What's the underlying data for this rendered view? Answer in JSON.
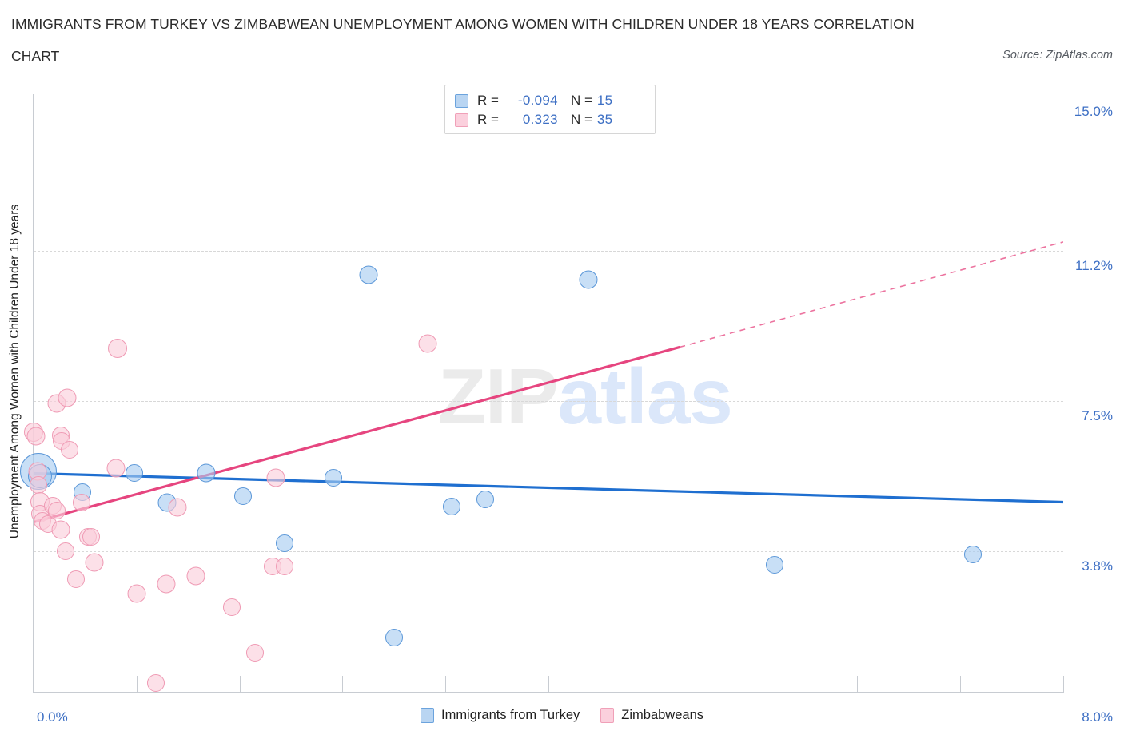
{
  "header": {
    "title_line1": "IMMIGRANTS FROM TURKEY VS ZIMBABWEAN UNEMPLOYMENT AMONG WOMEN WITH CHILDREN UNDER 18 YEARS CORRELATION",
    "title_line2": "CHART",
    "source": "Source: ZipAtlas.com"
  },
  "watermark": {
    "part1": "ZIP",
    "part2": "atlas"
  },
  "correlation_box": {
    "rows": [
      {
        "series": "Immigrants from Turkey",
        "r_label": "R =",
        "r_value": "-0.094",
        "n_label": "N =",
        "n_value": "15",
        "color": "#b9d5f2"
      },
      {
        "series": "Zimbabweans",
        "r_label": "R =",
        "r_value": "0.323",
        "n_label": "N =",
        "n_value": "35",
        "color": "#fbd0dd"
      }
    ]
  },
  "legend": {
    "items": [
      {
        "label": "Immigrants from Turkey",
        "color": "#b9d5f2"
      },
      {
        "label": "Zimbabweans",
        "color": "#fbd0dd"
      }
    ]
  },
  "chart_data": {
    "type": "scatter",
    "title": "IMMIGRANTS FROM TURKEY VS ZIMBABWEAN UNEMPLOYMENT AMONG WOMEN WITH CHILDREN UNDER 18 YEARS CORRELATION CHART",
    "xlabel": "Immigrants from Turkey",
    "ylabel": "Unemployment Among Women with Children Under 18 years",
    "xlim": [
      0.0,
      8.0
    ],
    "ylim": [
      0.45,
      15.0
    ],
    "xticks": [
      "0.0%",
      "8.0%"
    ],
    "yticks": [
      "15.0%",
      "11.2%",
      "7.5%",
      "3.8%"
    ],
    "ytick_values": [
      15.0,
      11.2,
      7.5,
      3.8
    ],
    "grid": true,
    "legend_position": "bottom-center",
    "series": [
      {
        "name": "Immigrants from Turkey",
        "color": "#b9d5f2",
        "edge_color": "#5b97d8",
        "r": -0.094,
        "n": 15,
        "trendline": {
          "x0": 0.0,
          "y0": 5.72,
          "x1": 8.0,
          "y1": 5.01,
          "color": "#1f6fd0",
          "style": "solid"
        },
        "points": [
          {
            "x": 0.04,
            "y": 5.76,
            "size": 46
          },
          {
            "x": 0.05,
            "y": 5.66,
            "size": 30
          },
          {
            "x": 0.38,
            "y": 5.25,
            "size": 22
          },
          {
            "x": 0.78,
            "y": 5.73,
            "size": 22
          },
          {
            "x": 1.04,
            "y": 5.0,
            "size": 23
          },
          {
            "x": 1.34,
            "y": 5.73,
            "size": 23
          },
          {
            "x": 1.63,
            "y": 5.15,
            "size": 22
          },
          {
            "x": 1.95,
            "y": 3.99,
            "size": 22
          },
          {
            "x": 2.6,
            "y": 10.62,
            "size": 23
          },
          {
            "x": 2.33,
            "y": 5.61,
            "size": 22
          },
          {
            "x": 2.8,
            "y": 1.68,
            "size": 22
          },
          {
            "x": 3.25,
            "y": 4.9,
            "size": 22
          },
          {
            "x": 3.51,
            "y": 5.07,
            "size": 22
          },
          {
            "x": 4.31,
            "y": 10.5,
            "size": 23
          },
          {
            "x": 5.76,
            "y": 3.47,
            "size": 22
          },
          {
            "x": 7.3,
            "y": 3.73,
            "size": 22
          }
        ]
      },
      {
        "name": "Zimbabweans",
        "color": "#fbd0dd",
        "edge_color": "#ef9ab4",
        "r": 0.323,
        "n": 35,
        "trendline": {
          "x0": 0.0,
          "y0": 4.52,
          "x1": 5.02,
          "y1": 8.83,
          "x_dash_end": 8.0,
          "y_dash_end": 11.42,
          "color": "#e6457f",
          "style": "solid-then-dashed"
        },
        "points": [
          {
            "x": 0.0,
            "y": 6.74,
            "size": 24
          },
          {
            "x": 0.02,
            "y": 6.63,
            "size": 23
          },
          {
            "x": 0.03,
            "y": 5.76,
            "size": 23
          },
          {
            "x": 0.04,
            "y": 5.43,
            "size": 22
          },
          {
            "x": 0.05,
            "y": 5.03,
            "size": 24
          },
          {
            "x": 0.05,
            "y": 4.72,
            "size": 22
          },
          {
            "x": 0.07,
            "y": 4.55,
            "size": 22
          },
          {
            "x": 0.11,
            "y": 4.46,
            "size": 22
          },
          {
            "x": 0.18,
            "y": 7.45,
            "size": 23
          },
          {
            "x": 0.21,
            "y": 6.65,
            "size": 22
          },
          {
            "x": 0.22,
            "y": 6.52,
            "size": 22
          },
          {
            "x": 0.26,
            "y": 7.57,
            "size": 23
          },
          {
            "x": 0.28,
            "y": 6.3,
            "size": 22
          },
          {
            "x": 0.15,
            "y": 4.93,
            "size": 22
          },
          {
            "x": 0.18,
            "y": 4.8,
            "size": 22
          },
          {
            "x": 0.21,
            "y": 4.33,
            "size": 23
          },
          {
            "x": 0.25,
            "y": 3.8,
            "size": 22
          },
          {
            "x": 0.33,
            "y": 3.11,
            "size": 22
          },
          {
            "x": 0.37,
            "y": 5.0,
            "size": 22
          },
          {
            "x": 0.42,
            "y": 4.15,
            "size": 22
          },
          {
            "x": 0.45,
            "y": 4.15,
            "size": 22
          },
          {
            "x": 0.47,
            "y": 3.53,
            "size": 23
          },
          {
            "x": 0.65,
            "y": 8.8,
            "size": 24
          },
          {
            "x": 0.64,
            "y": 5.85,
            "size": 23
          },
          {
            "x": 0.8,
            "y": 2.76,
            "size": 23
          },
          {
            "x": 0.95,
            "y": 0.55,
            "size": 22
          },
          {
            "x": 1.03,
            "y": 3.0,
            "size": 23
          },
          {
            "x": 1.12,
            "y": 4.88,
            "size": 23
          },
          {
            "x": 1.26,
            "y": 3.19,
            "size": 23
          },
          {
            "x": 1.54,
            "y": 2.42,
            "size": 22
          },
          {
            "x": 1.72,
            "y": 1.3,
            "size": 22
          },
          {
            "x": 1.86,
            "y": 3.42,
            "size": 22
          },
          {
            "x": 1.95,
            "y": 3.43,
            "size": 22
          },
          {
            "x": 1.88,
            "y": 5.62,
            "size": 23
          },
          {
            "x": 3.06,
            "y": 8.91,
            "size": 23
          }
        ]
      }
    ]
  }
}
